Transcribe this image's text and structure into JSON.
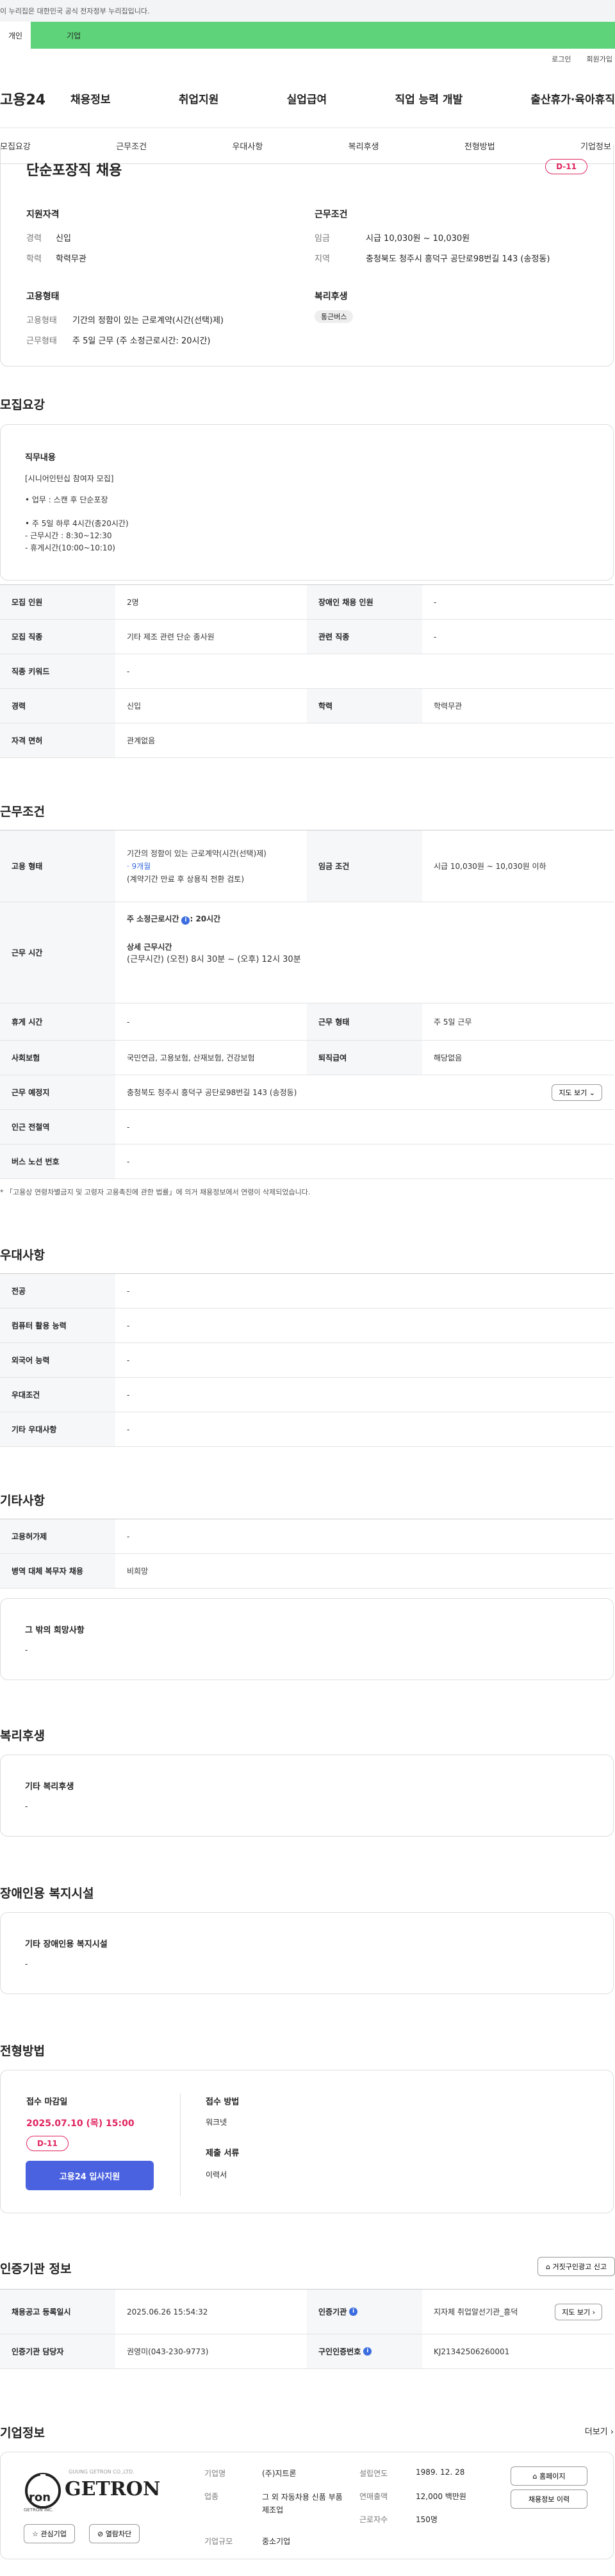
{
  "gov_banner": "이 누리집은 대한민국 공식 전자정부 누리집입니다.",
  "top_tabs": [
    "개인",
    "기업"
  ],
  "util": {
    "login": "로그인",
    "join": "회원가입"
  },
  "gnb": {
    "logo": "고용24",
    "items": [
      "채용정보",
      "취업지원",
      "실업급여",
      "직업 능력 개발",
      "출산휴가·육아휴직"
    ]
  },
  "lnb": [
    "모집요강",
    "근무조건",
    "우대사항",
    "복리후생",
    "전형방법",
    "기업정보"
  ],
  "summary": {
    "title": "단순포장직 채용",
    "dday": "D-11",
    "qual_title": "지원자격",
    "career_k": "경력",
    "career_v": "신입",
    "edu_k": "학력",
    "edu_v": "학력무관",
    "emp_title": "고용형태",
    "type_k": "고용형태",
    "type_v": "기간의 정함이 있는 근로계약(시간(선택)제)",
    "work_k": "근무형태",
    "work_v": "주 5일 근무 (주 소정근로시간: 20시간)",
    "cond_title": "근무조건",
    "wage_k": "임금",
    "wage_v": "시급 10,030원 ~ 10,030원",
    "region_k": "지역",
    "region_v": "충청북도 청주시 흥덕구 공단로98번길 143 (송정동)",
    "welfare_title": "복리후생",
    "welfare_badge": "통근버스"
  },
  "recruit": {
    "heading": "모집요강",
    "duty_title": "직무내용",
    "duty_lines": [
      "[시니어인턴십 참여자 모집]",
      "• 업무 : 스캔 후 단순포장",
      "• 주 5일 하루 4시간(총20시간)",
      " - 근무시간 : 8:30~12:30",
      " - 휴게시간(10:00~10:10)"
    ],
    "rows": [
      {
        "k1": "모집 인원",
        "v1": "2명",
        "k2": "장애인 채용 인원",
        "v2": "-"
      },
      {
        "k1": "모집 직종",
        "v1": "기타 제조 관련 단순 종사원",
        "k2": "관련 직종",
        "v2": "-"
      },
      {
        "k1": "직종 키워드",
        "v1": "-"
      },
      {
        "k1": "경력",
        "v1": "신입",
        "k2": "학력",
        "v2": "학력무관"
      },
      {
        "k1": "자격 면허",
        "v1": "관계없음"
      }
    ]
  },
  "conditions": {
    "heading": "근무조건",
    "emp_k": "고용 형태",
    "emp_v1": "기간의 정함이 있는 근로계약(시간(선택)제)",
    "emp_v2": "· 9개월",
    "emp_v3": "(계약기간 만료 후 상용직 전환 검토)",
    "wage_k": "임금 조건",
    "wage_v": "시급 10,030원 ~ 10,030원 이하",
    "time_k": "근무 시간",
    "time_v1": "주 소정근로시간",
    "time_v1b": ": 20시간",
    "time_v2": "상세 근무시간",
    "time_v3": "(근무시간) (오전) 8시 30분 ~ (오후) 12시 30분",
    "rest_k": "휴게 시간",
    "rest_v": "-",
    "form_k": "근무 형태",
    "form_v": "주 5일 근무",
    "ins_k": "사회보험",
    "ins_v": "국민연금, 고용보험, 산재보험, 건강보험",
    "ret_k": "퇴직급여",
    "ret_v": "해당없음",
    "place_k": "근무 예정지",
    "place_v": "충청북도 청주시 흥덕구 공단로98번길 143 (송정동)",
    "map_btn": "지도 보기",
    "sub_k": "인근 전철역",
    "sub_v": "-",
    "bus_k": "버스 노선 번호",
    "bus_v": "-",
    "note": "* 「고용상 연령차별금지 및 고령자 고용촉진에 관한 법률」에 의거 채용정보에서 연령이 삭제되었습니다."
  },
  "prefer": {
    "heading": "우대사항",
    "rows": [
      {
        "k": "전공",
        "v": "-"
      },
      {
        "k": "컴퓨터 활용 능력",
        "v": "-"
      },
      {
        "k": "외국어 능력",
        "v": "-"
      },
      {
        "k": "우대조건",
        "v": "-"
      },
      {
        "k": "기타 우대사항",
        "v": "-"
      }
    ]
  },
  "etc": {
    "heading": "기타사항",
    "rows": [
      {
        "k": "고용허가제",
        "v": "-"
      },
      {
        "k": "병역 대체 복무자 채용",
        "v": "비희망"
      }
    ],
    "hope_title": "그 밖의 희망사항",
    "hope_v": "-"
  },
  "welfare": {
    "heading": "복리후생",
    "title": "기타 복리후생",
    "v": "-"
  },
  "disabled": {
    "heading": "장애인용 복지시설",
    "title": "기타 장애인용 복지시설",
    "v": "-"
  },
  "selection": {
    "heading": "전형방법",
    "deadline_title": "접수 마감일",
    "deadline_v": "2025.07.10 (목) 15:00",
    "dday": "D-11",
    "method_title": "접수 방법",
    "method_v": "워크넷",
    "docs_title": "제출 서류",
    "docs_v": "이력서",
    "apply": "고용24 입사지원"
  },
  "cert": {
    "heading": "인증기관 정보",
    "report_btn": "거짓구인광고 신고",
    "reg_k": "채용공고 등록일시",
    "reg_v": "2025.06.26 15:54:32",
    "org_k": "인증기관",
    "org_v": "지자체 취업알선기관_흥덕",
    "map_btn": "지도 보기",
    "mgr_k": "인증기관 담당자",
    "mgr_v": "권영미(043-230-9773)",
    "no_k": "구인인증번호",
    "no_v": "KJ21342506260001"
  },
  "company": {
    "heading": "기업정보",
    "more": "더보기",
    "logo_small": "GUUNG GETRON CO.,LTD.",
    "logo_text": "GETRON",
    "logo_sub": "GETRON INC.",
    "fav_btn": "관심기업",
    "block_btn": "열람차단",
    "name_k": "기업명",
    "name_v": "(주)지트론",
    "ind_k": "업종",
    "ind_v": "그 외 자동차용 신품 부품 제조업",
    "scale_k": "기업규모",
    "scale_v": "중소기업",
    "year_k": "설립연도",
    "year_v": "1989. 12. 28",
    "sales_k": "연매출액",
    "sales_v": "12,000 백만원",
    "emp_k": "근로자수",
    "emp_v": "150명",
    "home_btn": "홈페이지",
    "history_btn": "채용정보 이력"
  }
}
